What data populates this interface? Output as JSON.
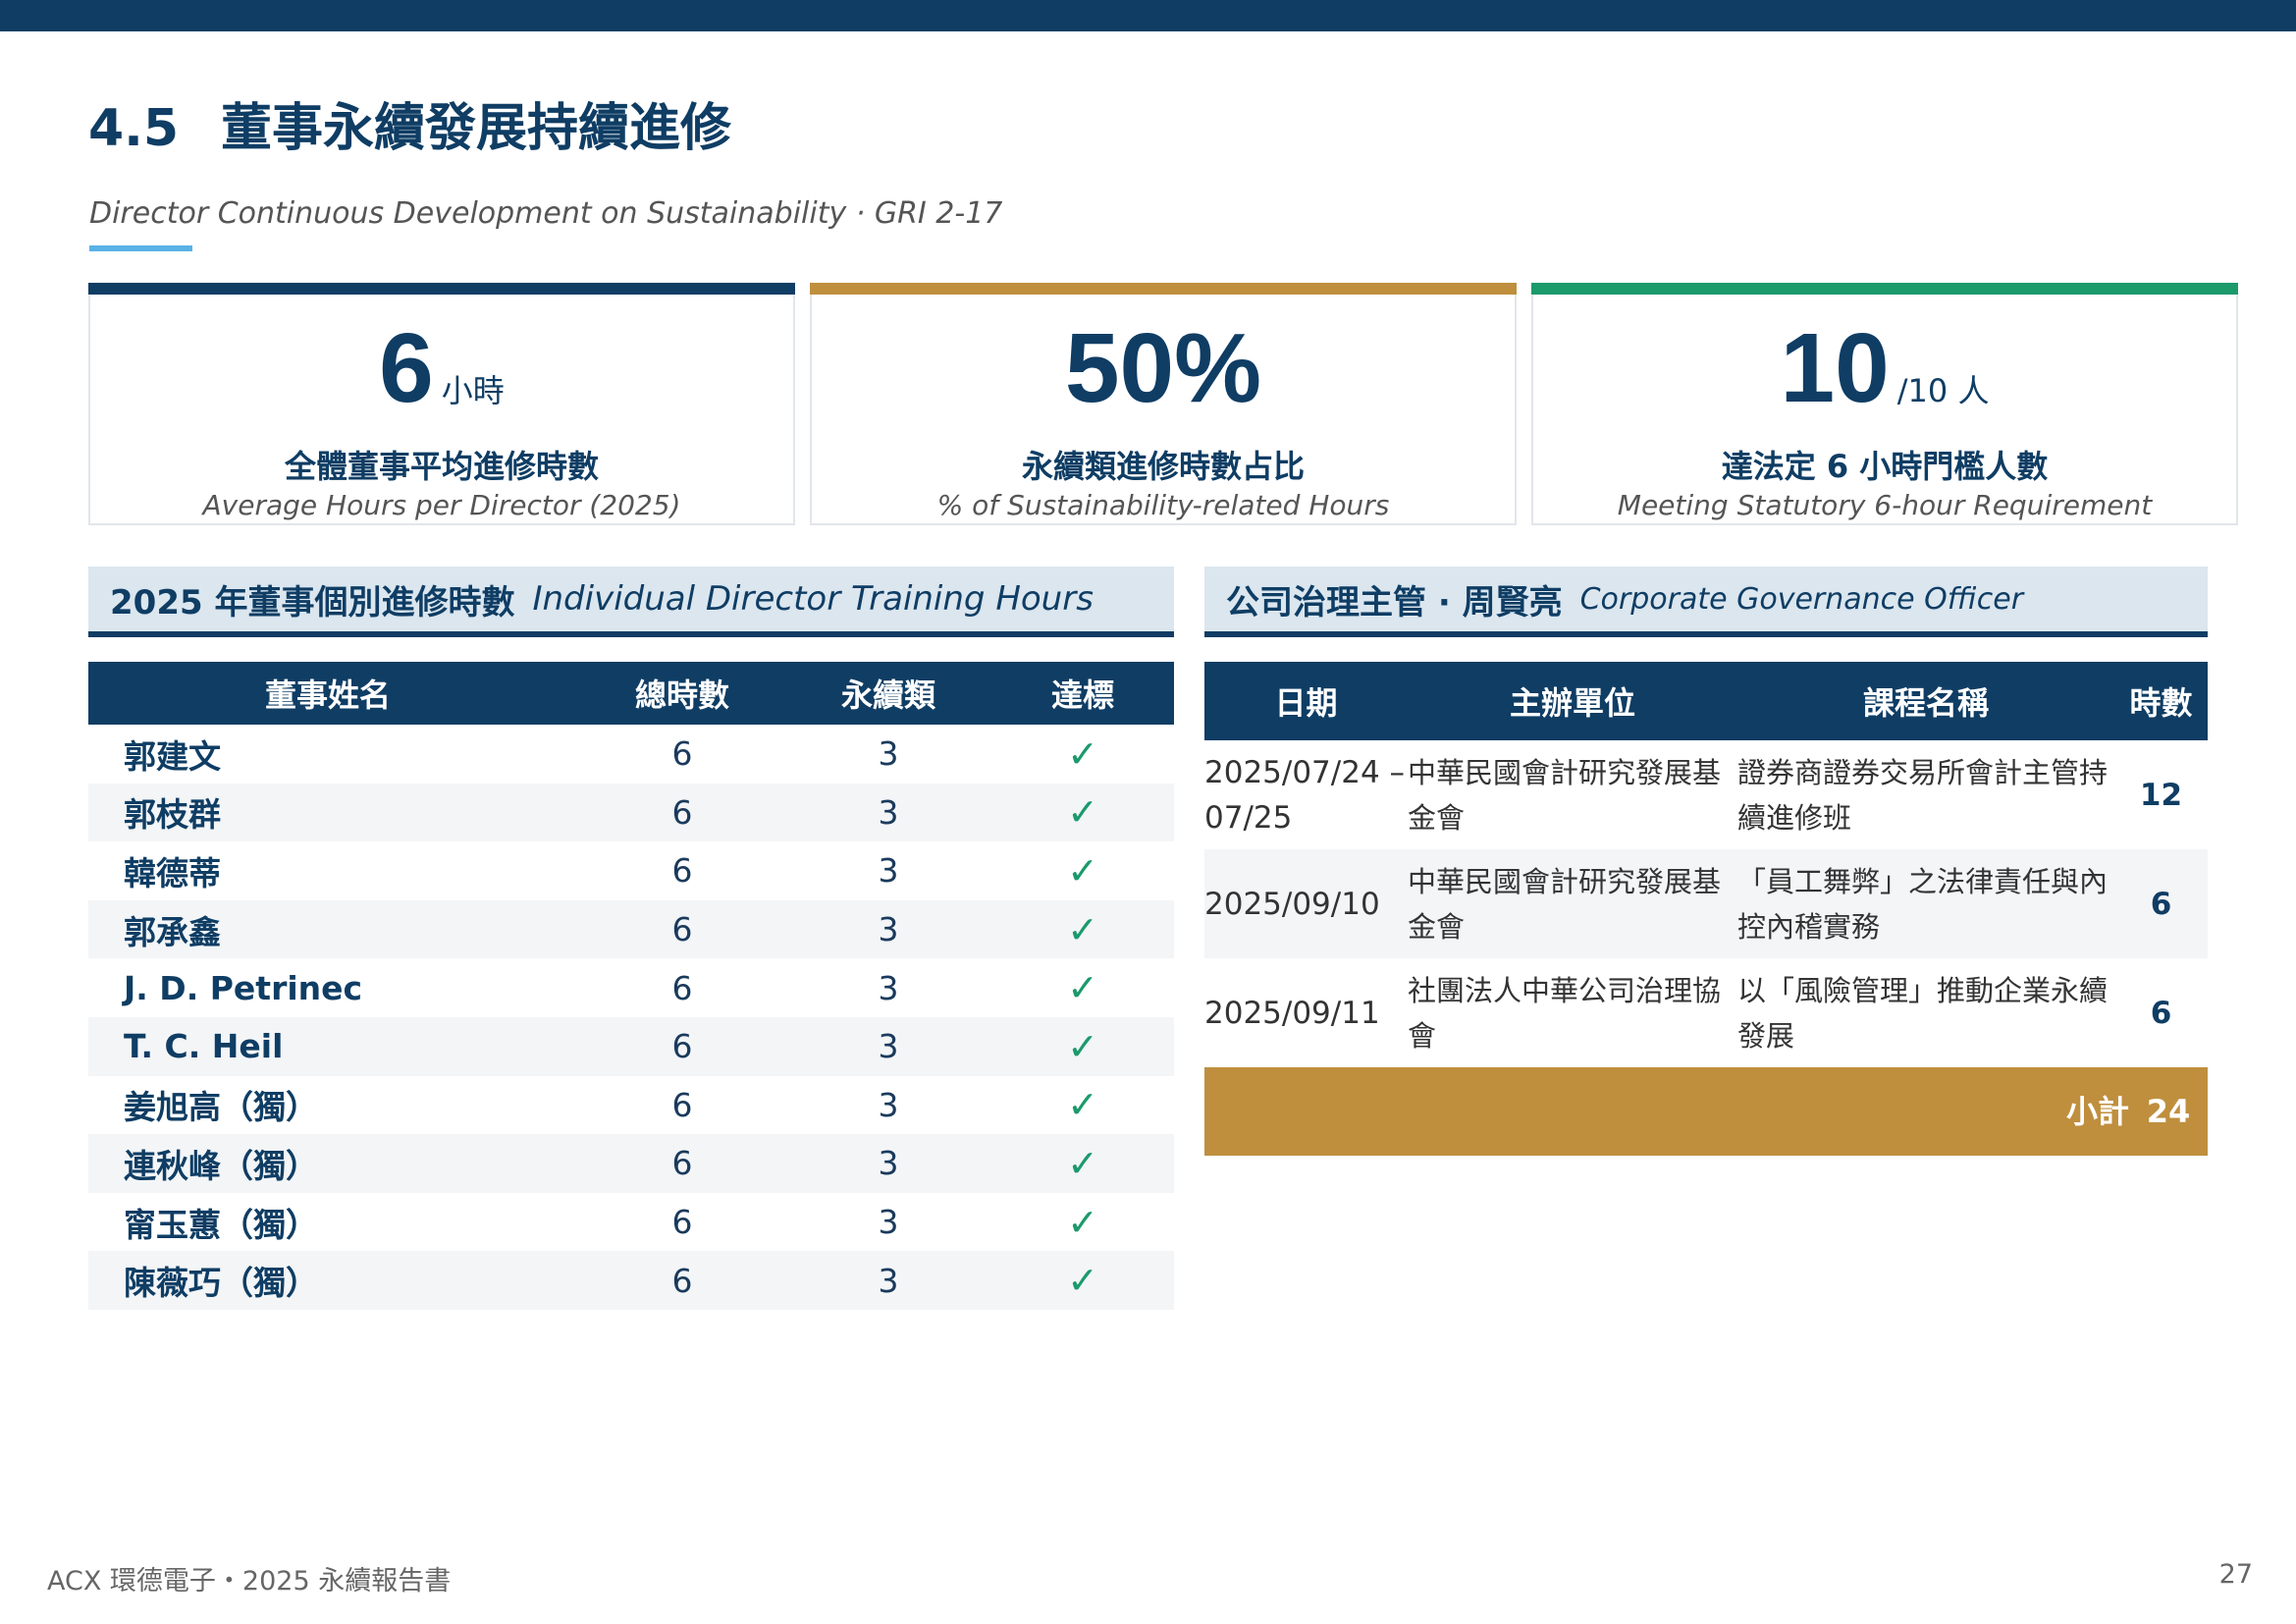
{
  "header": {
    "section_number": "4.5",
    "title": "董事永續發展持續進修",
    "subtitle": "Director Continuous Development on Sustainability · GRI 2-17"
  },
  "kpis": [
    {
      "value": "6",
      "unit": "小時",
      "label": "全體董事平均進修時數",
      "sub": "Average Hours per Director (2025)",
      "color": "#0f3d64"
    },
    {
      "value": "50%",
      "unit": "",
      "label": "永續類進修時數占比",
      "sub": "% of Sustainability-related Hours",
      "color": "#bf8f3e"
    },
    {
      "value": "10",
      "unit": "/10 人",
      "label": "達法定 6 小時門檻人數",
      "sub": "Meeting Statutory 6-hour Requirement",
      "color": "#1b9a6b"
    }
  ],
  "directors": {
    "title_zh": "2025 年董事個別進修時數",
    "title_en": "Individual Director Training Hours",
    "columns": [
      "董事姓名",
      "總時數",
      "永續類",
      "達標"
    ],
    "check_mark": "✓",
    "rows": [
      {
        "name": "郭建文",
        "total": "6",
        "sustain": "3"
      },
      {
        "name": "郭枝群",
        "total": "6",
        "sustain": "3"
      },
      {
        "name": "韓德蒂",
        "total": "6",
        "sustain": "3"
      },
      {
        "name": "郭承鑫",
        "total": "6",
        "sustain": "3"
      },
      {
        "name": "J. D. Petrinec",
        "total": "6",
        "sustain": "3"
      },
      {
        "name": "T. C. Heil",
        "total": "6",
        "sustain": "3"
      },
      {
        "name": "姜旭高（獨）",
        "total": "6",
        "sustain": "3"
      },
      {
        "name": "連秋峰（獨）",
        "total": "6",
        "sustain": "3"
      },
      {
        "name": "甯玉蕙（獨）",
        "total": "6",
        "sustain": "3"
      },
      {
        "name": "陳薇巧（獨）",
        "total": "6",
        "sustain": "3"
      }
    ]
  },
  "officer": {
    "title_zh": "公司治理主管 · 周賢亮",
    "title_en": "Corporate Governance Officer",
    "columns": [
      "日期",
      "主辦單位",
      "課程名稱",
      "時數"
    ],
    "rows": [
      {
        "date_1": "2025/07/24 –",
        "date_2": "07/25",
        "org_1": "中華民國會計研究發展基",
        "org_2": "金會",
        "course_1": "證券商證券交易所會計主管持",
        "course_2": "續進修班",
        "hours": "12"
      },
      {
        "date_1": "2025/09/10",
        "date_2": "",
        "org_1": "中華民國會計研究發展基",
        "org_2": "金會",
        "course_1": "「員工舞弊」之法律責任與內",
        "course_2": "控內稽實務",
        "hours": "6"
      },
      {
        "date_1": "2025/09/11",
        "date_2": "",
        "org_1": "社團法人中華公司治理協",
        "org_2": "會",
        "course_1": "以「風險管理」推動企業永續",
        "course_2": "發展",
        "hours": "6"
      }
    ],
    "total_label": "小計",
    "total_value": "24"
  },
  "footer": {
    "text": "ACX 環德電子・2025 永續報告書",
    "page": "27"
  }
}
